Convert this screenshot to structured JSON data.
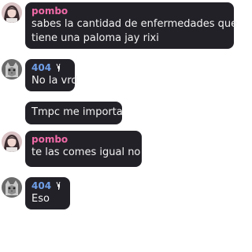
{
  "messages": [
    {
      "user": "pombo",
      "name_color": "#f06aa7",
      "avatar": "girl-avatar",
      "lines": [
        "sabes la cantidad de enfermedades que",
        "tiene una paloma jay rixi"
      ]
    },
    {
      "user": "404",
      "name_color": "#6f9fe8",
      "avatar": "cat-avatar",
      "badge": "deer-badge-icon",
      "lines": [
        "No la vrd"
      ]
    },
    {
      "lines": [
        "Tmpc me importa"
      ]
    },
    {
      "user": "pombo",
      "name_color": "#f06aa7",
      "avatar": "girl-avatar",
      "lines": [
        "te las comes igual no"
      ]
    },
    {
      "user": "404",
      "name_color": "#6f9fe8",
      "avatar": "cat-avatar",
      "badge": "deer-badge-icon",
      "lines": [
        "Eso"
      ]
    }
  ],
  "colors": {
    "bubble": "#232128",
    "text": "#f2f2f2"
  }
}
